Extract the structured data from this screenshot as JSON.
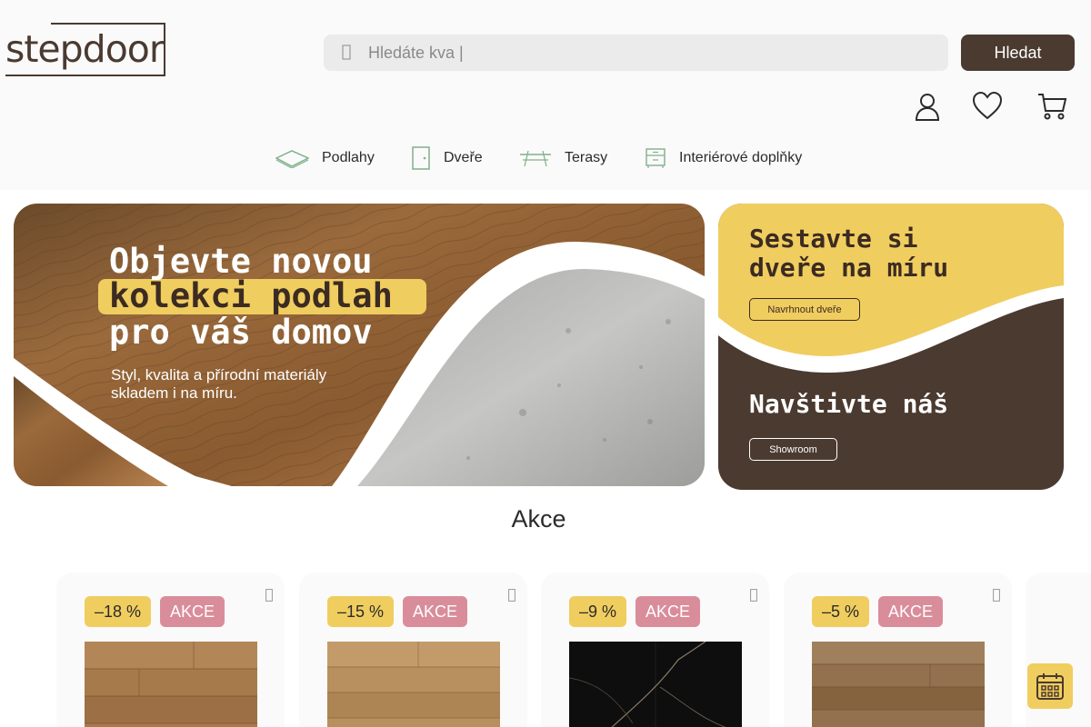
{
  "brand": {
    "logo_text": "stepdoor"
  },
  "search": {
    "placeholder": "Hledáte kva |",
    "button_label": "Hledat"
  },
  "nav": [
    {
      "label": "Podlahy",
      "icon": "floor-icon"
    },
    {
      "label": "Dveře",
      "icon": "door-icon"
    },
    {
      "label": "Terasy",
      "icon": "terrace-icon"
    },
    {
      "label": "Interiérové doplňky",
      "icon": "cabinet-icon"
    }
  ],
  "hero": {
    "line1": "Objevte novou",
    "line2": "kolekci podlah",
    "line3": "pro váš domov",
    "sub1": "Styl, kvalita a přírodní materiály",
    "sub2": "skladem i na míru."
  },
  "side": {
    "title1": "Sestavte si",
    "title2": "dveře na míru",
    "button1": "Navrhnout dveře",
    "title3": "Navštivte náš",
    "button2": "Showroom"
  },
  "section": {
    "title": "Akce"
  },
  "products": [
    {
      "discount": "–18 %",
      "badge": "AKCE"
    },
    {
      "discount": "–15 %",
      "badge": "AKCE"
    },
    {
      "discount": "–9 %",
      "badge": "AKCE"
    },
    {
      "discount": "–5 %",
      "badge": "AKCE"
    }
  ],
  "colors": {
    "brand_brown": "#4a3a30",
    "accent_yellow": "#f0cd5f",
    "badge_pink": "#d98d9b",
    "nav_icon_green": "#7fb08a"
  }
}
